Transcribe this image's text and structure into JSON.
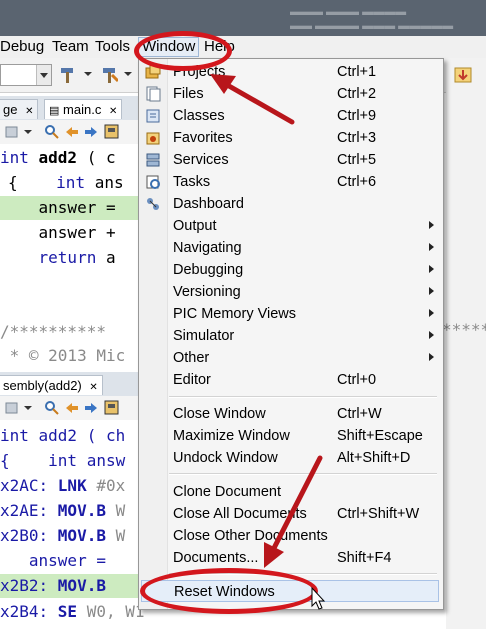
{
  "menubar": {
    "items": [
      "Debug",
      "Team",
      "Tools",
      "Window",
      "Help"
    ]
  },
  "tabs_top": [
    {
      "label": "ge"
    },
    {
      "label": "main.c"
    }
  ],
  "tab_bottom": {
    "label": "sembly(add2)"
  },
  "editor_top": {
    "lines": [
      {
        "a": "int ",
        "b": "add2",
        "c": " ( c"
      },
      {
        "a": "{    ",
        "b": "int",
        "c": " ans"
      },
      {
        "a": "    answer ="
      },
      {
        "a": "    answer +"
      },
      {
        "a": "    ",
        "b": "return",
        "c": " a"
      },
      {
        "a": ""
      },
      {
        "a": "/**********"
      },
      {
        "a": " * © 2013 Mic"
      }
    ],
    "right_comment": "*****"
  },
  "editor_bottom": {
    "lines": [
      {
        "a": "int add2 ( ch"
      },
      {
        "a": "{    int answ"
      },
      {
        "addr": "x2AC: ",
        "op": "LNK",
        "rest": " #0x"
      },
      {
        "addr": "x2AE: ",
        "op": "MOV.B",
        "rest": " W"
      },
      {
        "addr": "x2B0: ",
        "op": "MOV.B",
        "rest": " W"
      },
      {
        "a": "   answer ="
      },
      {
        "addr": "x2B2: ",
        "op": "MOV.B",
        "rest": ""
      },
      {
        "addr": "x2B4: ",
        "op": "SE",
        "rest": " W0, W1"
      }
    ]
  },
  "window_menu": {
    "items": [
      {
        "label": "Projects",
        "shortcut": "Ctrl+1",
        "icon": "projects-icon"
      },
      {
        "label": "Files",
        "shortcut": "Ctrl+2",
        "icon": "files-icon"
      },
      {
        "label": "Classes",
        "shortcut": "Ctrl+9",
        "icon": "classes-icon"
      },
      {
        "label": "Favorites",
        "shortcut": "Ctrl+3",
        "icon": "favorites-icon"
      },
      {
        "label": "Services",
        "shortcut": "Ctrl+5",
        "icon": "services-icon"
      },
      {
        "label": "Tasks",
        "shortcut": "Ctrl+6",
        "icon": "tasks-icon"
      },
      {
        "label": "Dashboard",
        "shortcut": "",
        "icon": "dashboard-icon"
      },
      {
        "label": "Output",
        "submenu": true
      },
      {
        "label": "Navigating",
        "submenu": true
      },
      {
        "label": "Debugging",
        "submenu": true
      },
      {
        "label": "Versioning",
        "submenu": true
      },
      {
        "label": "PIC Memory Views",
        "submenu": true
      },
      {
        "label": "Simulator",
        "submenu": true
      },
      {
        "label": "Other",
        "submenu": true
      },
      {
        "label": "Editor",
        "shortcut": "Ctrl+0"
      },
      {
        "label": "Close Window",
        "shortcut": "Ctrl+W"
      },
      {
        "label": "Maximize Window",
        "shortcut": "Shift+Escape"
      },
      {
        "label": "Undock Window",
        "shortcut": "Alt+Shift+D"
      },
      {
        "label": "Clone Document",
        "shortcut": ""
      },
      {
        "label": "Close All Documents",
        "shortcut": "Ctrl+Shift+W"
      },
      {
        "label": "Close Other Documents",
        "shortcut": ""
      },
      {
        "label": "Documents...",
        "shortcut": "Shift+F4"
      },
      {
        "label": "Reset Windows",
        "shortcut": ""
      }
    ]
  },
  "colors": {
    "highlight_line": "#cdebc0",
    "annotation_red": "#d3171d",
    "keyword": "#1a1aa6"
  }
}
